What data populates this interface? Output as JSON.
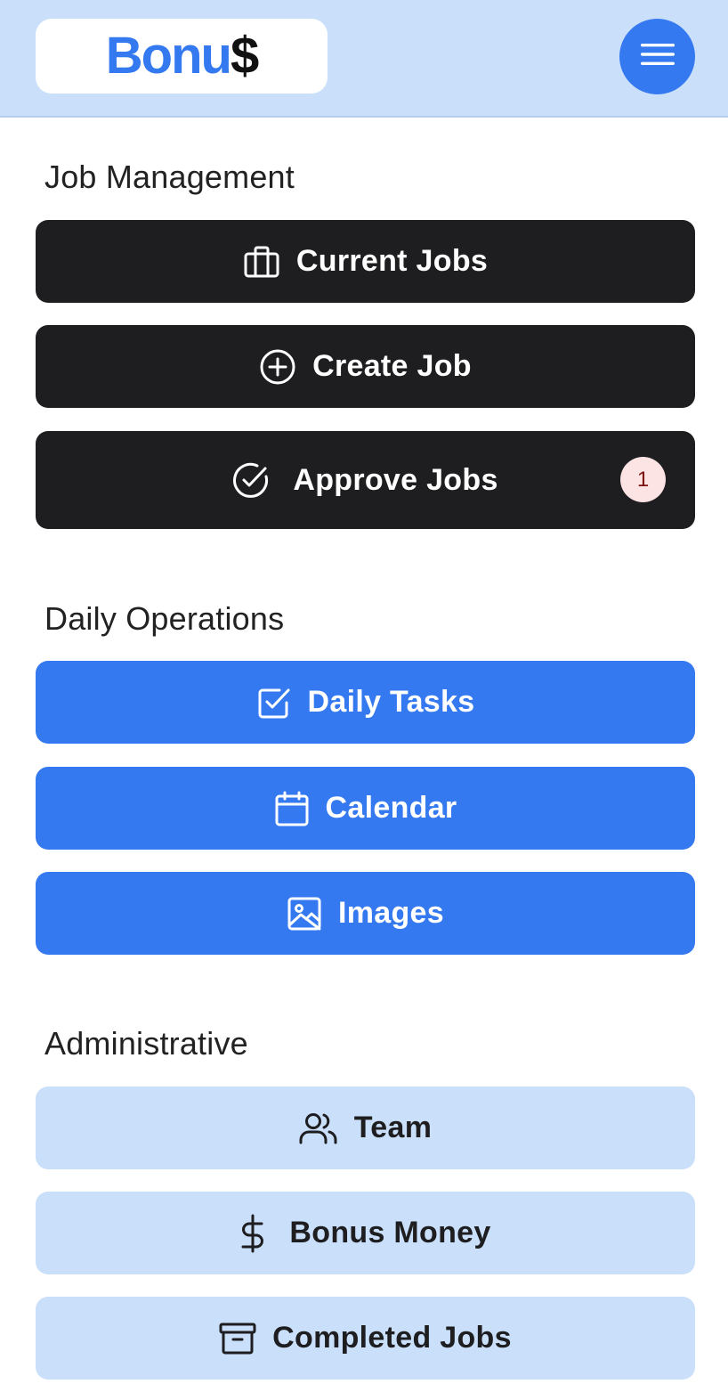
{
  "header": {
    "logo_main": "Bonu",
    "logo_dollar": "$",
    "menu_icon": "hamburger-menu-icon",
    "background_color": "#cadffa",
    "accent_color": "#3479f0"
  },
  "sections": {
    "job_management": {
      "title": "Job Management",
      "buttons": [
        {
          "label": "Current Jobs",
          "icon": "briefcase-icon"
        },
        {
          "label": "Create Job",
          "icon": "plus-circle-icon"
        },
        {
          "label": "Approve Jobs",
          "icon": "check-circle-icon",
          "badge": "1"
        }
      ],
      "button_color": "#1e1e20"
    },
    "daily_operations": {
      "title": "Daily Operations",
      "buttons": [
        {
          "label": "Daily Tasks",
          "icon": "checkbox-icon"
        },
        {
          "label": "Calendar",
          "icon": "calendar-icon"
        },
        {
          "label": "Images",
          "icon": "image-icon"
        }
      ],
      "button_color": "#3479f0"
    },
    "administrative": {
      "title": "Administrative",
      "buttons": [
        {
          "label": "Team",
          "icon": "users-icon"
        },
        {
          "label": "Bonus Money",
          "icon": "dollar-icon"
        },
        {
          "label": "Completed Jobs",
          "icon": "archive-icon"
        }
      ],
      "button_color": "#cadffa"
    }
  },
  "badge_color": "#fde4e4"
}
